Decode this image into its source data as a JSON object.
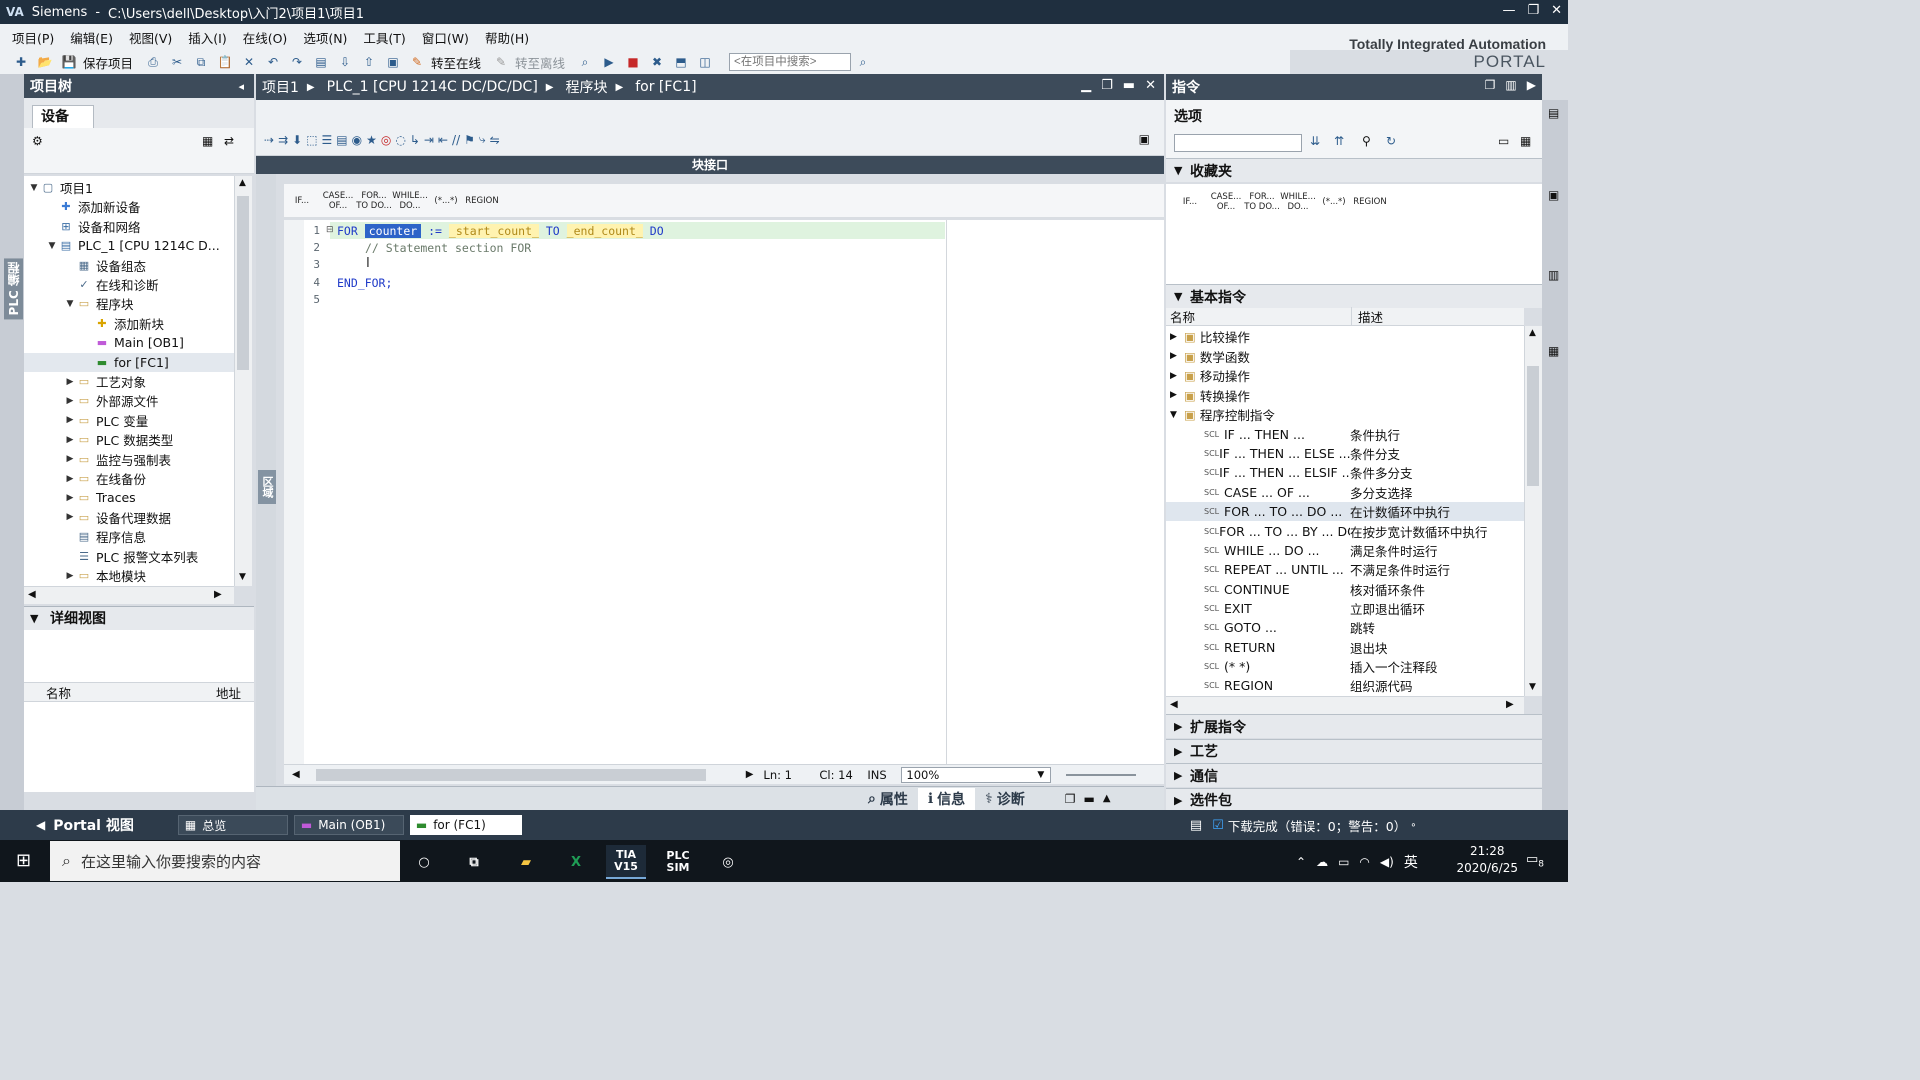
{
  "window": {
    "app_name": "Siemens",
    "path": "C:\\Users\\dell\\Desktop\\入门2\\项目1\\项目1"
  },
  "menu": [
    "项目(P)",
    "编辑(E)",
    "视图(V)",
    "插入(I)",
    "在线(O)",
    "选项(N)",
    "工具(T)",
    "窗口(W)",
    "帮助(H)"
  ],
  "brand": {
    "line1": "Totally Integrated Automation",
    "line2": "PORTAL"
  },
  "toolbar": {
    "save_label": "保存项目",
    "go_online": "转至在线",
    "go_offline": "转至离线",
    "search_placeholder": "<在项目中搜索>"
  },
  "left": {
    "vertical_tab": "PLC 编程",
    "header": "项目树",
    "device_tab": "设备",
    "tree": [
      {
        "label": "项目1",
        "level": 0,
        "arrow": "down",
        "icon": "project-icon"
      },
      {
        "label": "添加新设备",
        "level": 1,
        "arrow": "",
        "icon": "add-device-icon"
      },
      {
        "label": "设备和网络",
        "level": 1,
        "arrow": "",
        "icon": "network-icon"
      },
      {
        "label": "PLC_1 [CPU 1214C D...",
        "level": 1,
        "arrow": "down",
        "icon": "plc-icon"
      },
      {
        "label": "设备组态",
        "level": 2,
        "arrow": "",
        "icon": "device-config-icon"
      },
      {
        "label": "在线和诊断",
        "level": 2,
        "arrow": "",
        "icon": "diagnostics-icon"
      },
      {
        "label": "程序块",
        "level": 2,
        "arrow": "down",
        "icon": "folder-icon"
      },
      {
        "label": "添加新块",
        "level": 3,
        "arrow": "",
        "icon": "add-block-icon"
      },
      {
        "label": "Main [OB1]",
        "level": 3,
        "arrow": "",
        "icon": "ob-block-icon"
      },
      {
        "label": "for [FC1]",
        "level": 3,
        "arrow": "",
        "icon": "fc-block-icon"
      },
      {
        "label": "工艺对象",
        "level": 2,
        "arrow": "right",
        "icon": "folder-icon"
      },
      {
        "label": "外部源文件",
        "level": 2,
        "arrow": "right",
        "icon": "folder-icon"
      },
      {
        "label": "PLC 变量",
        "level": 2,
        "arrow": "right",
        "icon": "folder-icon"
      },
      {
        "label": "PLC 数据类型",
        "level": 2,
        "arrow": "right",
        "icon": "folder-icon"
      },
      {
        "label": "监控与强制表",
        "level": 2,
        "arrow": "right",
        "icon": "folder-icon"
      },
      {
        "label": "在线备份",
        "level": 2,
        "arrow": "right",
        "icon": "folder-icon"
      },
      {
        "label": "Traces",
        "level": 2,
        "arrow": "right",
        "icon": "folder-icon"
      },
      {
        "label": "设备代理数据",
        "level": 2,
        "arrow": "right",
        "icon": "folder-icon"
      },
      {
        "label": "程序信息",
        "level": 2,
        "arrow": "",
        "icon": "info-icon"
      },
      {
        "label": "PLC 报警文本列表",
        "level": 2,
        "arrow": "",
        "icon": "list-icon"
      },
      {
        "label": "本地模块",
        "level": 2,
        "arrow": "right",
        "icon": "folder-icon"
      }
    ],
    "selected_index": 9,
    "detail_header": "详细视图",
    "detail_columns": [
      "名称",
      "地址"
    ]
  },
  "editor": {
    "breadcrumbs": [
      "项目1",
      "PLC_1 [CPU 1214C DC/DC/DC]",
      "程序块",
      "for [FC1]"
    ],
    "block_interface": "块接口",
    "side_tab": "区域",
    "snippets": [
      "IF...",
      "CASE...\nOF...",
      "FOR...\nTO DO...",
      "WHILE...\nDO...",
      "(*...*)",
      "REGION"
    ],
    "lines": [
      {
        "n": "1",
        "kw1": "FOR",
        "var": "counter",
        "op": ":=",
        "start": "_start_count_",
        "to": "TO",
        "end": "_end_count_",
        "do": "DO"
      },
      {
        "n": "2",
        "comment": "// Statement section FOR"
      },
      {
        "n": "3"
      },
      {
        "n": "4",
        "text": "END_FOR;"
      },
      {
        "n": "5"
      }
    ],
    "status": {
      "ln": "Ln: 1",
      "cl": "Cl: 14",
      "mode": "INS",
      "zoom": "100%"
    }
  },
  "inspector_tabs": [
    "属性",
    "信息",
    "诊断"
  ],
  "right": {
    "header": "指令",
    "options_label": "选项",
    "favorites": "收藏夹",
    "fav_snippets": [
      "IF...",
      "CASE...\nOF...",
      "FOR...\nTO DO...",
      "WHILE...\nDO...",
      "(*...*)",
      "REGION"
    ],
    "basic": "基本指令",
    "columns": [
      "名称",
      "描述"
    ],
    "groups": [
      {
        "name": "比较操作",
        "open": false
      },
      {
        "name": "数学函数",
        "open": false
      },
      {
        "name": "移动操作",
        "open": false
      },
      {
        "name": "转换操作",
        "open": false
      },
      {
        "name": "程序控制指令",
        "open": true
      }
    ],
    "instructions": [
      {
        "name": "IF ... THEN ...",
        "desc": "条件执行"
      },
      {
        "name": "IF ... THEN ... ELSE ...",
        "desc": "条件分支"
      },
      {
        "name": "IF ... THEN ... ELSIF ...",
        "desc": "条件多分支"
      },
      {
        "name": "CASE ... OF ...",
        "desc": "多分支选择"
      },
      {
        "name": "FOR ... TO ... DO ...",
        "desc": "在计数循环中执行"
      },
      {
        "name": "FOR ... TO ... BY ... DO...",
        "desc": "在按步宽计数循环中执行"
      },
      {
        "name": "WHILE ... DO ...",
        "desc": "满足条件时运行"
      },
      {
        "name": "REPEAT ... UNTIL ...",
        "desc": "不满足条件时运行"
      },
      {
        "name": "CONTINUE",
        "desc": "核对循环条件"
      },
      {
        "name": "EXIT",
        "desc": "立即退出循环"
      },
      {
        "name": "GOTO ...",
        "desc": "跳转"
      },
      {
        "name": "RETURN",
        "desc": "退出块"
      },
      {
        "name": "(* *)",
        "desc": "插入一个注释段"
      },
      {
        "name": "REGION",
        "desc": "组织源代码"
      }
    ],
    "scl_tag": "SCL",
    "selected_instruction": 4,
    "sections": [
      "扩展指令",
      "工艺",
      "通信",
      "选件包"
    ]
  },
  "portal_bar": {
    "portal_view": "Portal 视图",
    "tabs": [
      "总览",
      "Main (OB1)",
      "for (FC1)"
    ],
    "status": "下载完成（错误：0；警告：0）"
  },
  "taskbar": {
    "search_placeholder": "在这里输入你要搜索的内容",
    "apps": [
      "TIA V15",
      "PLC SIM"
    ],
    "lang": "英",
    "time": "21:28",
    "date": "2020/6/25",
    "notification_count": "8"
  }
}
